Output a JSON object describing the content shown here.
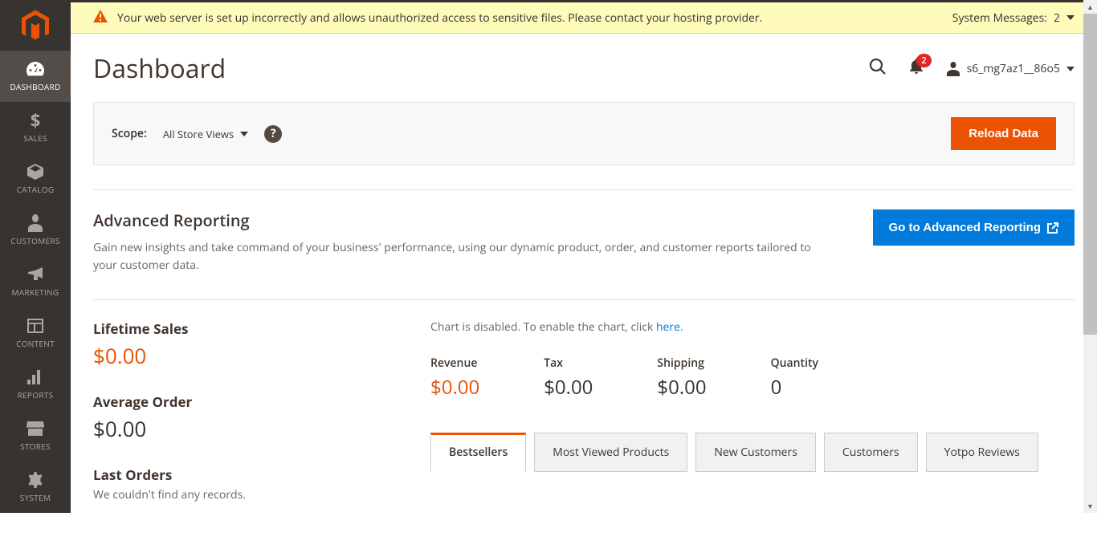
{
  "sidebar": {
    "items": [
      {
        "label": "DASHBOARD"
      },
      {
        "label": "SALES"
      },
      {
        "label": "CATALOG"
      },
      {
        "label": "CUSTOMERS"
      },
      {
        "label": "MARKETING"
      },
      {
        "label": "CONTENT"
      },
      {
        "label": "REPORTS"
      },
      {
        "label": "STORES"
      },
      {
        "label": "SYSTEM"
      }
    ]
  },
  "system_message": {
    "text": "Your web server is set up incorrectly and allows unauthorized access to sensitive files. Please contact your hosting provider.",
    "right_label": "System Messages:",
    "count": "2"
  },
  "header": {
    "title": "Dashboard",
    "notif_count": "2",
    "username": "s6_mg7az1__86o5"
  },
  "scope": {
    "label": "Scope:",
    "selected": "All Store Views",
    "reload_label": "Reload Data"
  },
  "advanced_reporting": {
    "title": "Advanced Reporting",
    "description": "Gain new insights and take command of your business' performance, using our dynamic product, order, and customer reports tailored to your customer data.",
    "button_label": "Go to Advanced Reporting"
  },
  "stats": {
    "lifetime_sales_label": "Lifetime Sales",
    "lifetime_sales_value": "$0.00",
    "avg_order_label": "Average Order",
    "avg_order_value": "$0.00",
    "last_orders_label": "Last Orders",
    "last_orders_empty": "We couldn't find any records."
  },
  "chart": {
    "disabled_prefix": "Chart is disabled. To enable the chart, click ",
    "link_text": "here",
    "metrics": [
      {
        "label": "Revenue",
        "value": "$0.00",
        "orange": true
      },
      {
        "label": "Tax",
        "value": "$0.00"
      },
      {
        "label": "Shipping",
        "value": "$0.00"
      },
      {
        "label": "Quantity",
        "value": "0"
      }
    ]
  },
  "tabs": [
    {
      "label": "Bestsellers",
      "active": true
    },
    {
      "label": "Most Viewed Products"
    },
    {
      "label": "New Customers"
    },
    {
      "label": "Customers"
    },
    {
      "label": "Yotpo Reviews"
    }
  ]
}
